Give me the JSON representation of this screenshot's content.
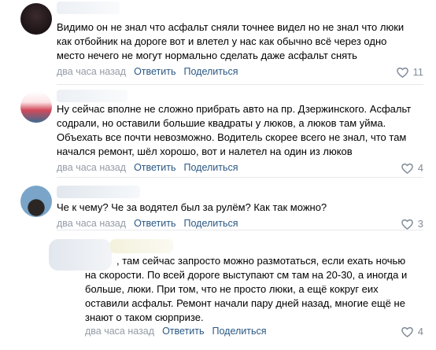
{
  "comments": [
    {
      "text": "Видимо он не знал что асфальт сняли точнее видел но не знал что люки\nкак отбойник на дороге вот и влетел у нас как обычно всё через одно\nместо нечего не могут нормально сделать даже асфальт снять",
      "time": "два часа назад",
      "reply": "Ответить",
      "share": "Поделиться",
      "likes": "11"
    },
    {
      "text": "Ну сейчас вполне не сложно прибрать авто на пр. Дзержинского. Асфальт\nсодрали, но оставили большие квадраты у люков, а люков там уйма.\nОбъехать все почти невозможно. Водитель скорее всего не знал, что там\nначался ремонт, шёл хорошо, вот и налетел на один из люков",
      "time": "два часа назад",
      "reply": "Ответить",
      "share": "Поделиться",
      "likes": "4"
    },
    {
      "text": "Че к чему? Че за водятел был за рулём? Как так можно?",
      "time": "два часа назад",
      "reply": "Ответить",
      "share": "Поделиться",
      "likes": "3"
    },
    {
      "text_first": ", там сейчас запросто можно размотаться, если ехать ночью",
      "text": "на скорости. По всей дороге выступают см там на 20-30, а иногда и\nбольше, люки. При том, что не просто люки, а ещё кокруг еих\nоставили асфальт. Ремонт начали пару дней назад, многие ещё не\nзнают о таком сюрпризе.",
      "time": "два часа назад",
      "reply": "Ответить",
      "share": "Поделиться",
      "likes": "4"
    }
  ],
  "colors": {
    "link": "#2a5885",
    "meta": "#818c99",
    "divider": "#e7e8ec"
  },
  "icons": {
    "like": "heart-icon"
  }
}
